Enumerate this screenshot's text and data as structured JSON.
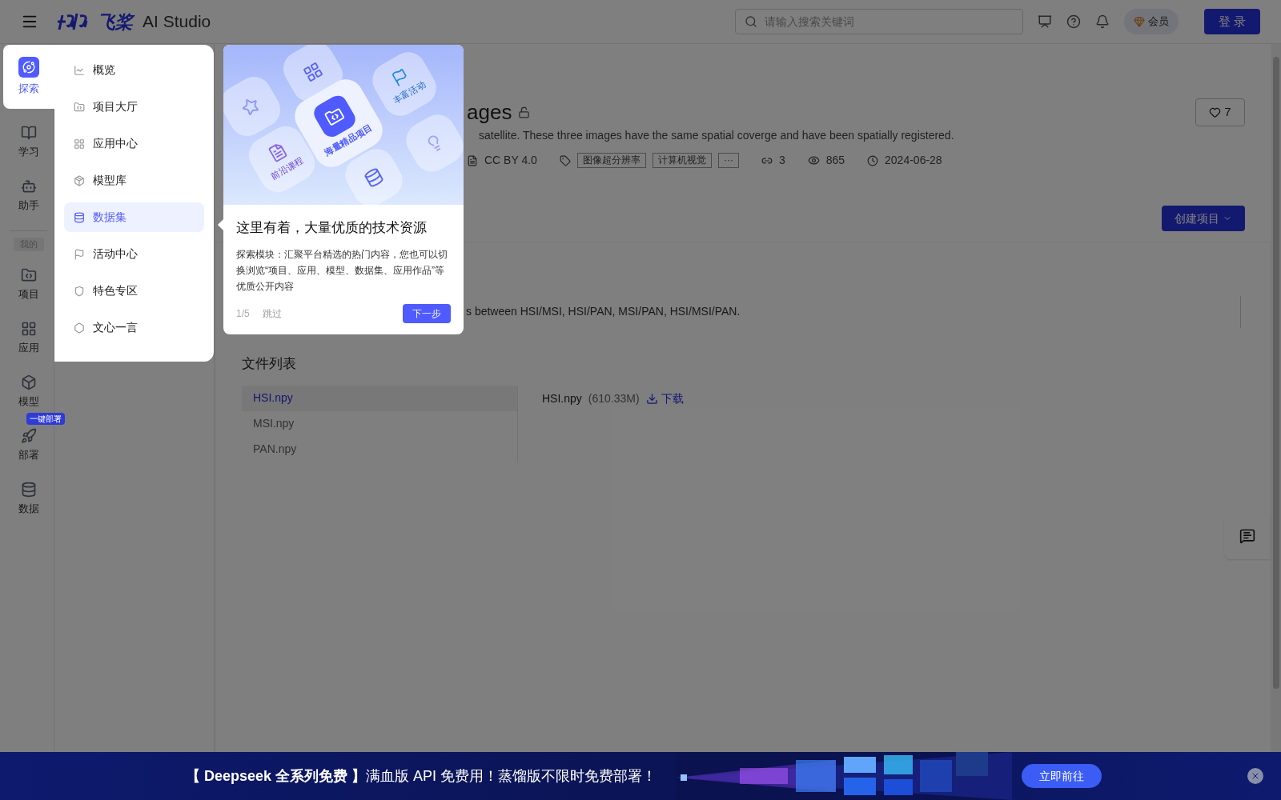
{
  "top_bar": {
    "logo": "飞桨",
    "product": "AI Studio",
    "search": {
      "placeholder": "请输入搜索关键词"
    },
    "member": "会员",
    "login": "登 录"
  },
  "rail": {
    "items": [
      {
        "label": "探索",
        "selected": true
      },
      {
        "label": "学习",
        "selected": false
      },
      {
        "label": "助手",
        "selected": false
      }
    ],
    "section_label": "我的",
    "my_items": [
      {
        "label": "项目",
        "selected": false
      },
      {
        "label": "应用",
        "selected": false
      },
      {
        "label": "模型",
        "selected": false
      },
      {
        "label": "部署",
        "selected": false,
        "badge": "一键部署"
      },
      {
        "label": "数据",
        "selected": false
      }
    ]
  },
  "explore_menu": {
    "items": [
      {
        "label": "概览",
        "selected": false
      },
      {
        "label": "项目大厅",
        "selected": false
      },
      {
        "label": "应用中心",
        "selected": false
      },
      {
        "label": "模型库",
        "selected": false
      },
      {
        "label": "数据集",
        "selected": true
      },
      {
        "label": "活动中心",
        "selected": false
      },
      {
        "label": "特色专区",
        "selected": false
      },
      {
        "label": "文心一言",
        "selected": false
      }
    ]
  },
  "tour": {
    "tiles": [
      {
        "label": "海量精品项目"
      },
      {
        "label": "前沿课程"
      },
      {
        "label": "丰富活动"
      }
    ],
    "title": "这里有着，大量优质的技术资源",
    "body": "探索模块：汇聚平台精选的热门内容，您也可以切换浏览“项目、应用、模型、数据集、应用作品”等优质公开内容",
    "step": "1/5",
    "skip": "跳过",
    "next": "下一步"
  },
  "dataset": {
    "title": "ages",
    "description": "satellite. These three images have the same spatial coverge and have been spatially registered.",
    "license": "CC BY 4.0",
    "tags": [
      "图像超分辨率",
      "计算机视觉",
      "···"
    ],
    "links": "3",
    "views": "865",
    "date": "2024-06-28",
    "likes": "7",
    "create_button": "创建项目",
    "note": "s between HSI/MSI, HSI/PAN, MSI/PAN, HSI/MSI/PAN."
  },
  "files": {
    "heading": "文件列表",
    "items": [
      {
        "name": "HSI.npy",
        "selected": true
      },
      {
        "name": "MSI.npy",
        "selected": false
      },
      {
        "name": "PAN.npy",
        "selected": false
      }
    ],
    "preview": {
      "name": "HSI.npy",
      "size": "(610.33M)",
      "download": "下载"
    }
  },
  "banner": {
    "text": "**【 Deepseek 全系列免费 】**满血版 API 免费用！蒸馏版不限时免费部署！",
    "button": "立即前往"
  }
}
